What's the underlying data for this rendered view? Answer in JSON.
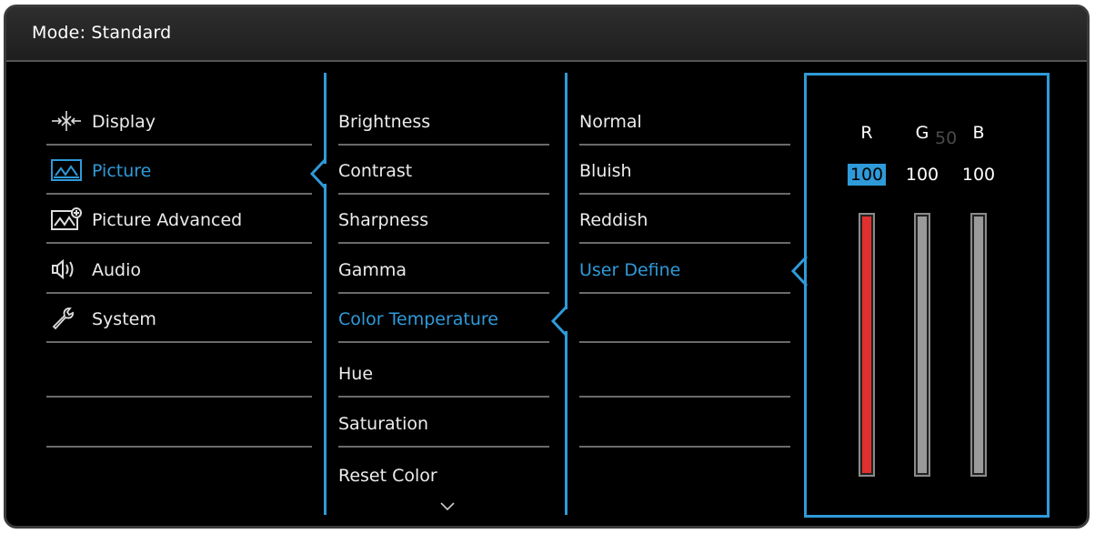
{
  "header": {
    "mode_label": "Mode: Standard"
  },
  "main_menu": [
    {
      "label": "Display",
      "icon": "display-icon",
      "active": false
    },
    {
      "label": "Picture",
      "icon": "picture-icon",
      "active": true
    },
    {
      "label": "Picture Advanced",
      "icon": "picture-advanced-icon",
      "active": false
    },
    {
      "label": "Audio",
      "icon": "audio-icon",
      "active": false
    },
    {
      "label": "System",
      "icon": "system-icon",
      "active": false
    }
  ],
  "picture_menu": [
    {
      "label": "Brightness"
    },
    {
      "label": "Contrast"
    },
    {
      "label": "Sharpness"
    },
    {
      "label": "Gamma"
    },
    {
      "label": "Color Temperature",
      "active": true
    },
    {
      "label": "Hue"
    },
    {
      "label": "Saturation"
    },
    {
      "label": "Reset Color"
    }
  ],
  "color_temp_menu": [
    {
      "label": "Normal"
    },
    {
      "label": "Bluish"
    },
    {
      "label": "Reddish"
    },
    {
      "label": "User Define",
      "active": true
    }
  ],
  "rgb": {
    "ghost_text": "50",
    "channels": [
      {
        "letter": "R",
        "value": "100",
        "level": 1.0,
        "color": "#e0302f",
        "selected": true
      },
      {
        "letter": "G",
        "value": "100",
        "level": 1.0,
        "color": "#9a9a9a",
        "selected": false
      },
      {
        "letter": "B",
        "value": "100",
        "level": 1.0,
        "color": "#9a9a9a",
        "selected": false
      }
    ]
  },
  "colors": {
    "accent": "#2f9ad9",
    "background": "#000000",
    "divider": "#6a6a6a"
  }
}
